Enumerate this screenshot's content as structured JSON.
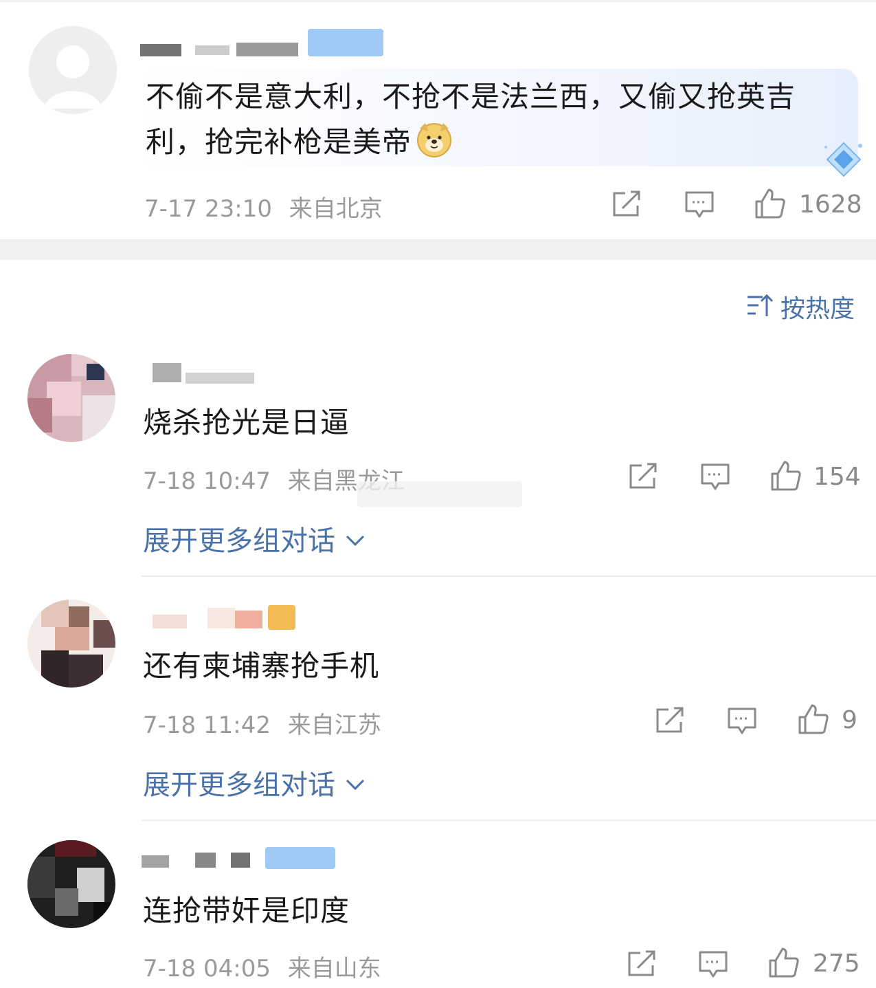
{
  "sort": {
    "label": "按热度"
  },
  "top_comment": {
    "text_line1": "不偷不是意大利，不抢不是法兰西，又偷又抢英吉",
    "text_line2": "利，抢完补枪是美帝",
    "emoji": "doge-emoji",
    "date": "7-17 23:10",
    "location": "来自北京",
    "likes": "1628"
  },
  "comments": [
    {
      "text": "烧杀抢光是日逼",
      "date": "7-18 10:47",
      "location": "来自黑龙江",
      "likes": "154",
      "expand_label": "展开更多组对话"
    },
    {
      "text": "还有柬埔寨抢手机",
      "date": "7-18 11:42",
      "location": "来自江苏",
      "likes": "9",
      "expand_label": "展开更多组对话"
    },
    {
      "text": "连抢带奸是印度",
      "date": "7-18 04:05",
      "location": "来自山东",
      "likes": "275"
    }
  ],
  "colors": {
    "accent": "#4a72a8",
    "meta": "#9a9a9a",
    "band": "#efefef"
  }
}
